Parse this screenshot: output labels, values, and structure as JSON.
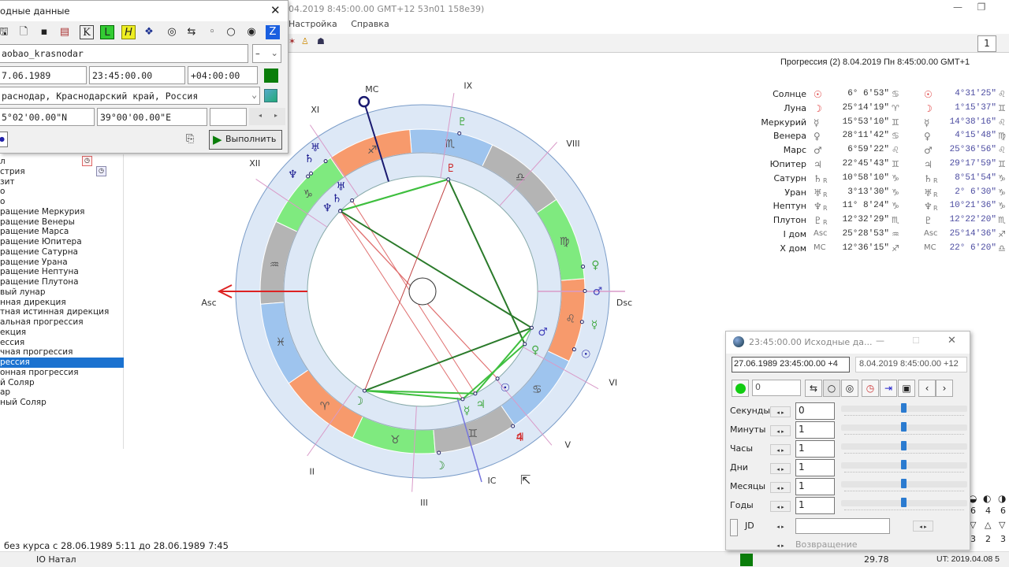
{
  "window": {
    "title": "04.2019  8:45:00.00 GMT+12 53n01 158e39)",
    "minimize_icon": "minimize-icon",
    "restore_icon": "restore-icon"
  },
  "menu": [
    "Настройка",
    "Справка"
  ],
  "toolbar": {
    "page_number": "1"
  },
  "source_dialog": {
    "title": "одные данные",
    "name": "aobao_krasnodar",
    "name_option": "–",
    "date": "7.06.1989",
    "time": "23:45:00.00",
    "timezone": "+04:00:00",
    "place": "раснодар, Краснодарский край, Россия",
    "latitude": "5°02'00.00\"N",
    "longitude": "39°00'00.00\"E",
    "extra": "",
    "run_label": "Выполнить",
    "toolbar_icons": [
      "open-icon",
      "new-icon",
      "save-icon",
      "table-icon",
      "k-icon",
      "l-icon",
      "h-icon",
      "book-icon",
      "rings-icon",
      "swap-icon",
      "circle-small-icon",
      "circle-icon",
      "circle-filled-icon",
      "z-icon"
    ]
  },
  "methods_list": {
    "items": [
      "л",
      "стрия",
      "зит",
      "о",
      "о",
      "ращение Меркурия",
      "ращение Венеры",
      "ращение Марса",
      "ращение Юпитера",
      "ращение Сатурна",
      "ращение Урана",
      "ращение Нептуна",
      "ращение Плутона",
      "вый лунар",
      "нная дирекция",
      "тная истинная дирекция",
      "альная прогрессия",
      "екция",
      "ессия",
      "чная прогрессия",
      "рессия",
      "онная прогрессия",
      "й Соляр",
      "ар",
      "ный Соляр"
    ],
    "selected_index": 20
  },
  "progression_header": "Прогрессия (2)  8.04.2019  Пн  8:45:00.00 GMT+1",
  "positions": [
    {
      "name": "Солнце",
      "glyph": "☉",
      "retro": "",
      "natal": "6° 6'53\"",
      "natal_sign": "♋",
      "prog_glyph": "☉",
      "prog_retro": "",
      "prog": "4°31'25\"",
      "prog_sign": "♌"
    },
    {
      "name": "Луна",
      "glyph": "☽",
      "retro": "",
      "natal": "25°14'19\"",
      "natal_sign": "♈",
      "prog_glyph": "☽",
      "prog_retro": "",
      "prog": "1°15'37\"",
      "prog_sign": "♊"
    },
    {
      "name": "Меркурий",
      "glyph": "☿",
      "retro": "",
      "natal": "15°53'10\"",
      "natal_sign": "♊",
      "prog_glyph": "☿",
      "prog_retro": "",
      "prog": "14°38'16\"",
      "prog_sign": "♌"
    },
    {
      "name": "Венера",
      "glyph": "♀",
      "retro": "",
      "natal": "28°11'42\"",
      "natal_sign": "♋",
      "prog_glyph": "♀",
      "prog_retro": "",
      "prog": "4°15'48\"",
      "prog_sign": "♍"
    },
    {
      "name": "Марс",
      "glyph": "♂",
      "retro": "",
      "natal": "6°59'22\"",
      "natal_sign": "♌",
      "prog_glyph": "♂",
      "prog_retro": "",
      "prog": "25°36'56\"",
      "prog_sign": "♌"
    },
    {
      "name": "Юпитер",
      "glyph": "♃",
      "retro": "",
      "natal": "22°45'43\"",
      "natal_sign": "♊",
      "prog_glyph": "♃",
      "prog_retro": "",
      "prog": "29°17'59\"",
      "prog_sign": "♊"
    },
    {
      "name": "Сатурн",
      "glyph": "♄",
      "retro": "R",
      "natal": "10°58'10\"",
      "natal_sign": "♑",
      "prog_glyph": "♄",
      "prog_retro": "R",
      "prog": "8°51'54\"",
      "prog_sign": "♑"
    },
    {
      "name": "Уран",
      "glyph": "♅",
      "retro": "R",
      "natal": "3°13'30\"",
      "natal_sign": "♑",
      "prog_glyph": "♅",
      "prog_retro": "R",
      "prog": "2° 6'30\"",
      "prog_sign": "♑"
    },
    {
      "name": "Нептун",
      "glyph": "♆",
      "retro": "R",
      "natal": "11° 8'24\"",
      "natal_sign": "♑",
      "prog_glyph": "♆",
      "prog_retro": "R",
      "prog": "10°21'36\"",
      "prog_sign": "♑"
    },
    {
      "name": "Плутон",
      "glyph": "♇",
      "retro": "R",
      "natal": "12°32'29\"",
      "natal_sign": "♏",
      "prog_glyph": "♇",
      "prog_retro": "",
      "prog": "12°22'20\"",
      "prog_sign": "♏"
    },
    {
      "name": "I дом",
      "glyph": "Asc",
      "retro": "",
      "natal": "25°28'53\"",
      "natal_sign": "♒",
      "prog_glyph": "Asc",
      "prog_retro": "",
      "prog": "25°14'36\"",
      "prog_sign": "♐"
    },
    {
      "name": "X дом",
      "glyph": "MC",
      "retro": "",
      "natal": "12°36'15\"",
      "natal_sign": "♐",
      "prog_glyph": "MC",
      "prog_retro": "",
      "prog": "22° 6'20\"",
      "prog_sign": "♎"
    }
  ],
  "chart": {
    "axis_labels": {
      "asc": "Asc",
      "dsc": "Dsc",
      "mc": "MC",
      "ic": "IC"
    },
    "house_labels": [
      "II",
      "III",
      "V",
      "VI",
      "VIII",
      "IX",
      "XI",
      "XII"
    ],
    "signs": [
      "♈",
      "♉",
      "♊",
      "♋",
      "♌",
      "♍",
      "♎",
      "♏",
      "♐",
      "♑",
      "♒",
      "♓"
    ],
    "element_colors": {
      "fire": "#f79a6c",
      "earth": "#7fea7f",
      "air": "#b4b4b4",
      "water": "#9ec4ee"
    },
    "ring_color": "#dde8f6",
    "planet_colors": [
      "#1a1aa0",
      "#228822",
      "#44aa44",
      "#44aa44",
      "#4444bb",
      "#44aa44",
      "#1a1a90",
      "#1a1a90",
      "#1a1a90",
      "#cc2222"
    ],
    "prog_colors": [
      "#1a1aa0",
      "#228822",
      "#44aa44",
      "#44aa44",
      "#4444bb",
      "#cc2222",
      "#1a1a90",
      "#1a1a90",
      "#1a1a90",
      "#44aa44"
    ],
    "progressed_asc_marker": "4",
    "aspects": [
      {
        "a": 6,
        "b": 0,
        "type": "opposition"
      },
      {
        "a": 8,
        "b": 0,
        "type": "opposition"
      },
      {
        "a": 7,
        "b": 5,
        "type": "opposition"
      },
      {
        "a": 6,
        "b": 2,
        "type": "opposition"
      },
      {
        "a": 6,
        "b": 9,
        "type": "sextile"
      },
      {
        "a": 8,
        "b": 9,
        "type": "sextile"
      },
      {
        "a": 9,
        "b": 3,
        "type": "trine"
      },
      {
        "a": 8,
        "b": 4,
        "type": "trine"
      },
      {
        "a": 1,
        "b": 4,
        "type": "trine"
      },
      {
        "a": 1,
        "b": 5,
        "type": "sextile"
      },
      {
        "a": 1,
        "b": 2,
        "type": "sextile"
      },
      {
        "a": 9,
        "b": 1,
        "type": "square"
      },
      {
        "a": 2,
        "b": 3,
        "type": "sextile"
      },
      {
        "a": 5,
        "b": 4,
        "type": "sextile"
      }
    ]
  },
  "moon_void": "без курса с 28.06.1989  5:11 до 28.06.1989  7:45",
  "status": {
    "tab": "IO Натал",
    "value": "29.78",
    "ut": "UT: 2019.04.08  5",
    "indicator_color": "#0a7d0a"
  },
  "counts": {
    "row1": [
      "6",
      "4",
      "6"
    ],
    "row2": [
      "3",
      "2",
      "3"
    ]
  },
  "time_dialog": {
    "title": "23:45:00.00 Исходные да...",
    "natal_datetime": "27.06.1989  23:45:00.00  +4",
    "target_datetime": "8.04.2019    8:45:00.00  +12",
    "counter": "0",
    "steps": [
      {
        "label": "Секунды",
        "value": "0",
        "slider": 0.5
      },
      {
        "label": "Минуты",
        "value": "1",
        "slider": 0.5
      },
      {
        "label": "Часы",
        "value": "1",
        "slider": 0.5
      },
      {
        "label": "Дни",
        "value": "1",
        "slider": 0.5
      },
      {
        "label": "Месяцы",
        "value": "1",
        "slider": 0.5
      },
      {
        "label": "Годы",
        "value": "1",
        "slider": 0.5
      }
    ],
    "jd_label": "JD",
    "jd_value": "",
    "return_label": "Возвращение"
  }
}
